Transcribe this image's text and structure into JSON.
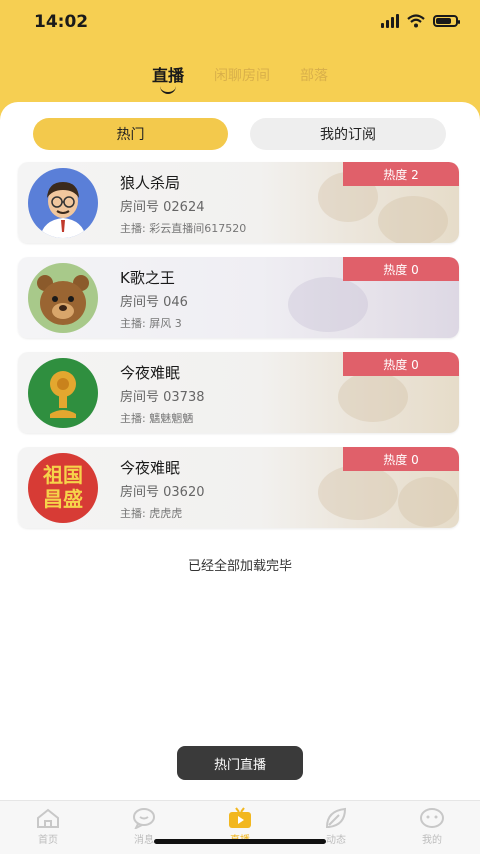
{
  "status_bar": {
    "time": "14:02"
  },
  "top_tabs": [
    {
      "label": "直播",
      "active": true
    },
    {
      "label": "闲聊房间",
      "active": false
    },
    {
      "label": "部落",
      "active": false
    }
  ],
  "segments": {
    "hot": "热门",
    "subscribed": "我的订阅"
  },
  "rooms": [
    {
      "name": "狼人杀局",
      "room_number": "房间号 02624",
      "host": "主播: 彩云直播间617520",
      "heat": "热度 2",
      "avatar": "man-with-glasses-avatar"
    },
    {
      "name": "K歌之王",
      "room_number": "房间号 046",
      "host": "主播: 屏风 3",
      "heat": "热度 0",
      "avatar": "bear-avatar"
    },
    {
      "name": "今夜难眠",
      "room_number": "房间号 03738",
      "host": "主播: 魑魅魍魉",
      "heat": "热度 0",
      "avatar": "gold-statue-avatar"
    },
    {
      "name": "今夜难眠",
      "room_number": "房间号 03620",
      "host": "主播: 虎虎虎",
      "heat": "热度 0",
      "avatar": "calligraphy-avatar"
    }
  ],
  "avatar_text": "祖国昌盛",
  "loaded_text": "已经全部加载完毕",
  "hot_live_button": "热门直播",
  "tabbar": [
    {
      "label": "首页",
      "icon": "home-icon",
      "active": false
    },
    {
      "label": "消息",
      "icon": "chat-icon",
      "active": false
    },
    {
      "label": "直播",
      "icon": "live-tv-icon",
      "active": true
    },
    {
      "label": "动态",
      "icon": "leaf-icon",
      "active": false
    },
    {
      "label": "我的",
      "icon": "face-icon",
      "active": false
    }
  ],
  "colors": {
    "brand_yellow": "#f6cf52",
    "heat_red": "#e0606a",
    "tab_active": "#f2b71f"
  }
}
